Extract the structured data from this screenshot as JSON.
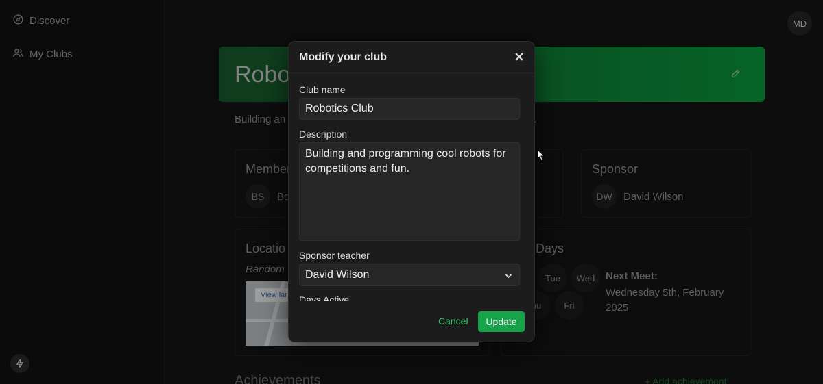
{
  "sidebar": {
    "items": [
      {
        "label": "Discover",
        "icon": "compass-icon"
      },
      {
        "label": "My Clubs",
        "icon": "users-icon"
      }
    ]
  },
  "header": {
    "avatar_initials": "MD"
  },
  "club": {
    "title_visible": "Robot",
    "description_visible_start": "Building an",
    "description_visible_end": "n.",
    "members": {
      "title": "Member",
      "initials": "BS",
      "name_partial": "Bo"
    },
    "sponsor": {
      "title": "Sponsor",
      "initials": "DW",
      "name": "David Wilson"
    },
    "location": {
      "title": "Locatio",
      "subtitle": "Random",
      "map_link": "View lar"
    },
    "days": {
      "title": "Days",
      "day_tue": "Tue",
      "day_wed": "Wed",
      "day_thu": "hu",
      "day_fri": "Fri",
      "next_meet_label": "Next Meet:",
      "next_meet_value": "Wednesday 5th, February 2025"
    },
    "achievements": {
      "title": "Achievements",
      "add_label": "+ Add achievement"
    }
  },
  "modal": {
    "title": "Modify your club",
    "club_name_label": "Club name",
    "club_name_value": "Robotics Club",
    "description_label": "Description",
    "description_value": "Building and programming cool robots for competitions and fun.",
    "sponsor_label": "Sponsor teacher",
    "sponsor_value": "David Wilson",
    "days_label": "Days Active",
    "cancel_label": "Cancel",
    "update_label": "Update"
  },
  "colors": {
    "accent": "#17a34a",
    "cancel_text": "#35c06a",
    "background": "#141414",
    "modal_bg": "#1c1c1c"
  }
}
